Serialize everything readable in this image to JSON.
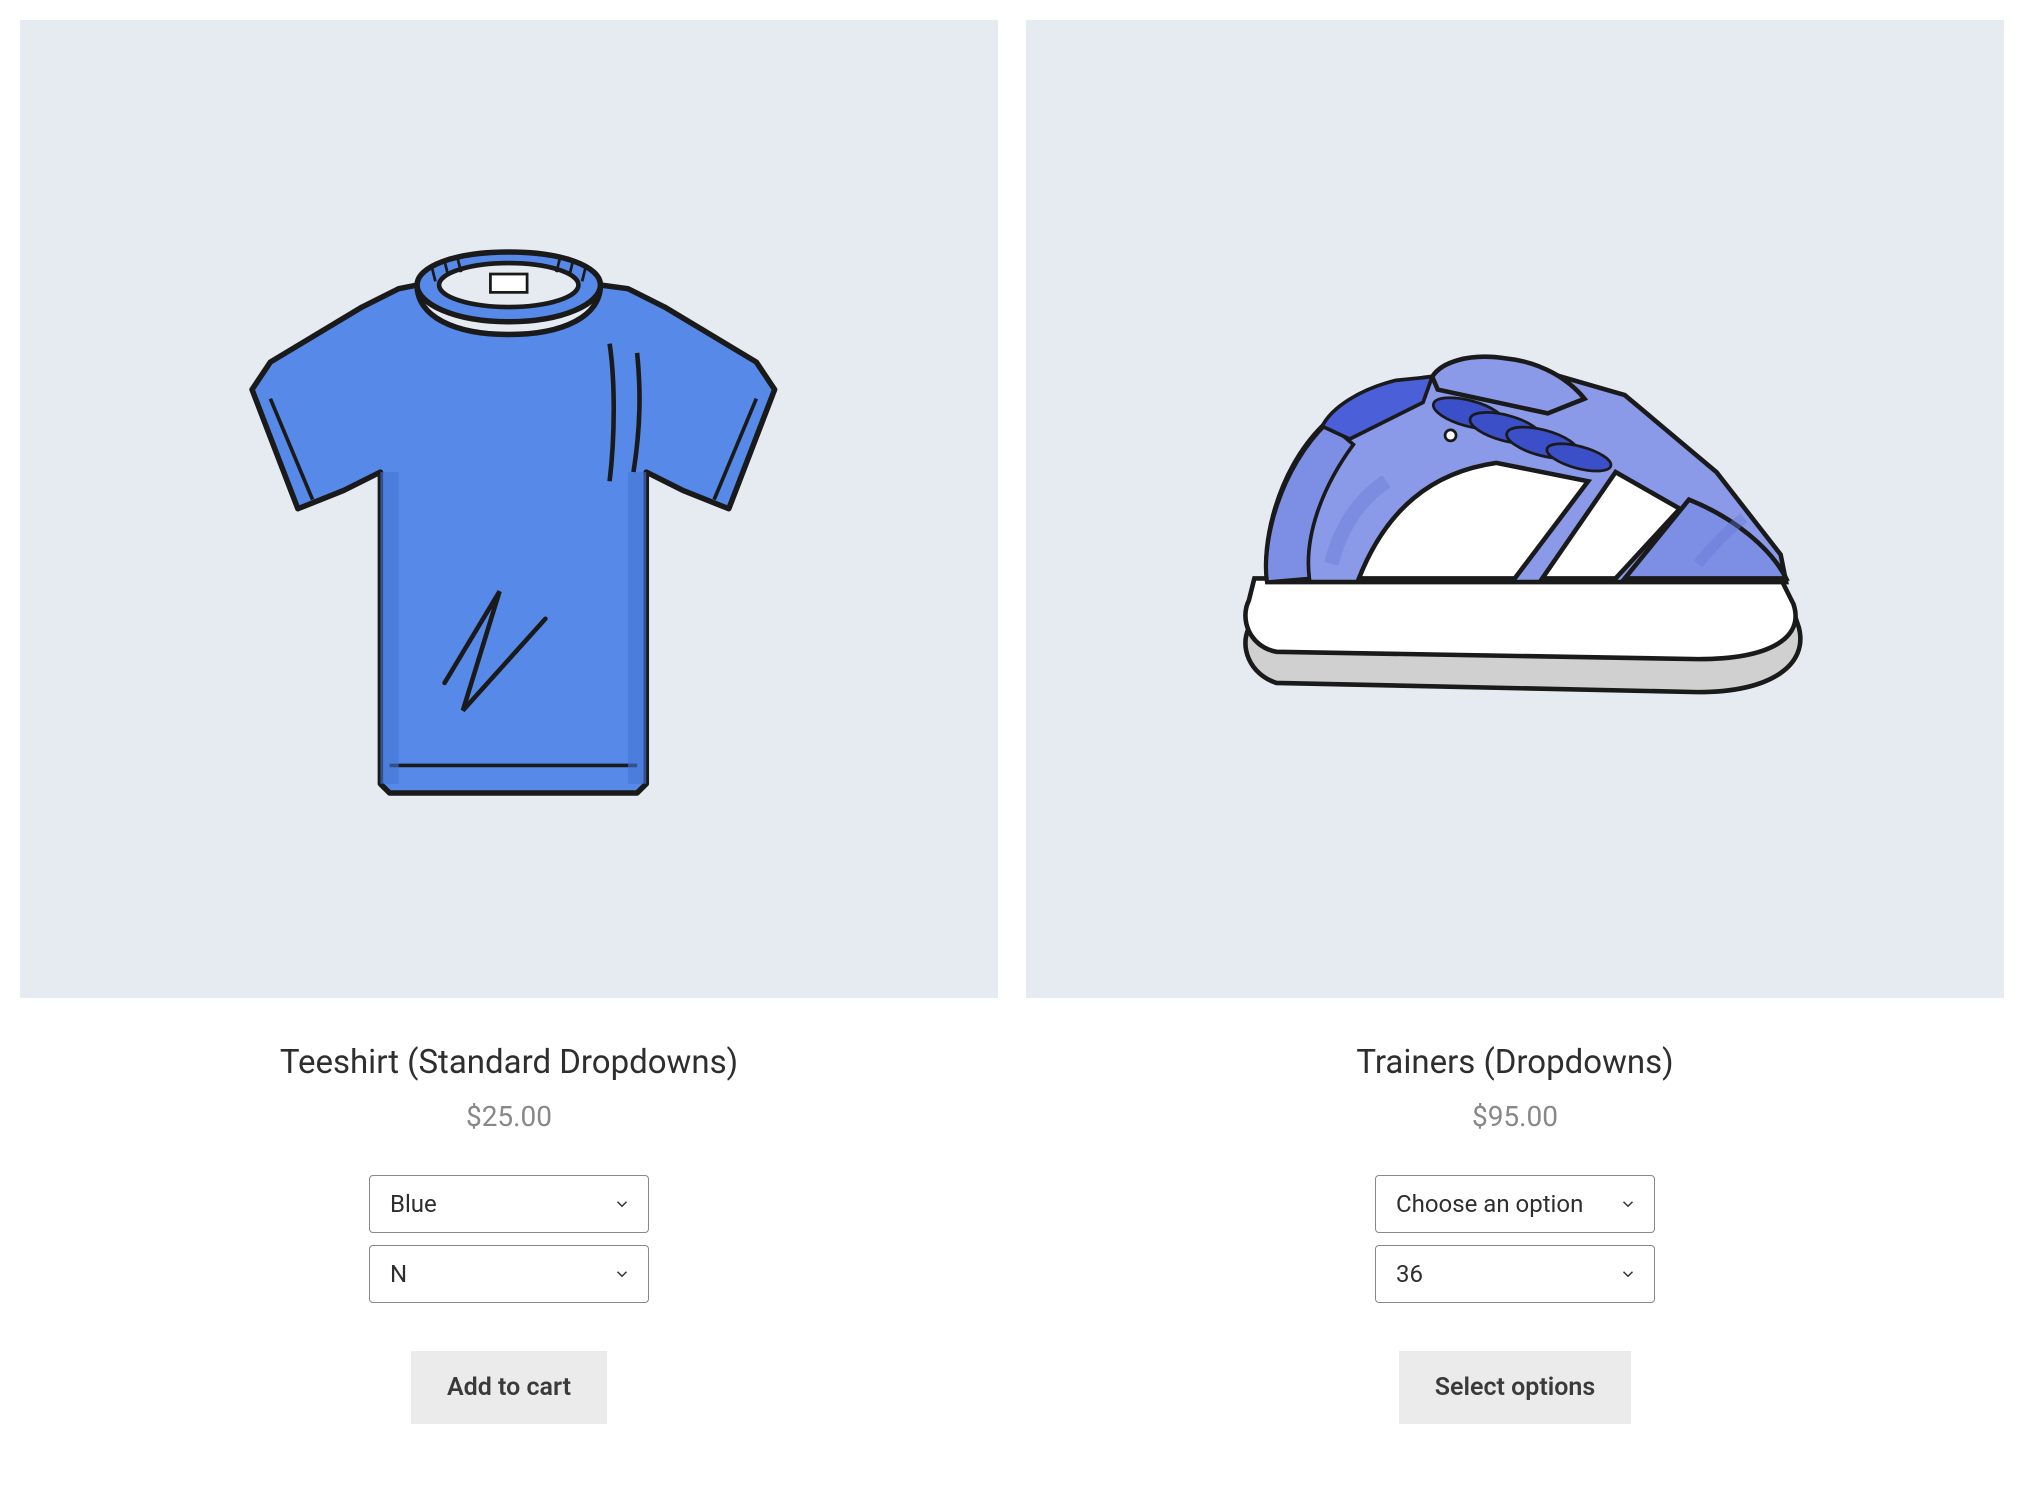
{
  "products": [
    {
      "title": "Teeshirt (Standard Dropdowns)",
      "price": "$25.00",
      "option1": "Blue",
      "option2": "N",
      "button": "Add to cart"
    },
    {
      "title": "Trainers (Dropdowns)",
      "price": "$95.00",
      "option1": "Choose an option",
      "option2": "36",
      "button": "Select options"
    }
  ]
}
